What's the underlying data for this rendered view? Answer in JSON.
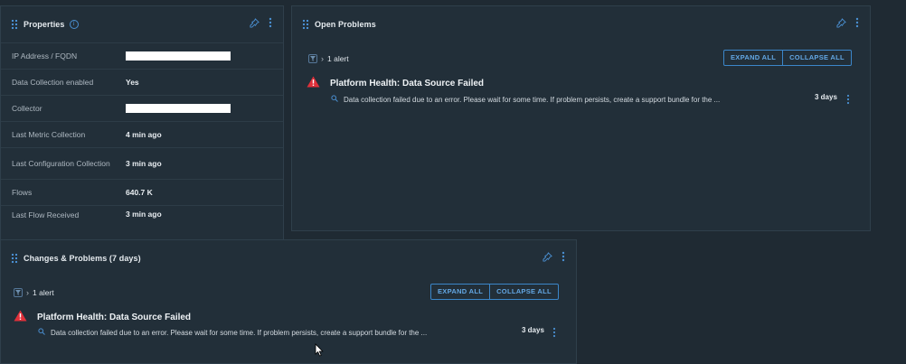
{
  "properties": {
    "title": "Properties",
    "rows": [
      {
        "key": "IP Address / FQDN",
        "value": ""
      },
      {
        "key": "Data Collection enabled",
        "value": "Yes"
      },
      {
        "key": "Collector",
        "value": ""
      },
      {
        "key": "Last Metric Collection",
        "value": "4 min ago"
      },
      {
        "key": "Last Configuration Collection",
        "value": "3 min ago"
      },
      {
        "key": "Flows",
        "value": "640.7 K"
      },
      {
        "key": "Last Flow Received",
        "value": "3 min ago"
      }
    ]
  },
  "open_problems": {
    "title": "Open Problems",
    "alert_count": "1 alert",
    "expand_all": "EXPAND ALL",
    "collapse_all": "COLLAPSE ALL",
    "alert": {
      "title": "Platform Health: Data Source Failed",
      "description": "Data collection failed due to an error. Please wait for some time. If problem persists, create a support bundle for the ...",
      "age": "3 days"
    }
  },
  "changes_problems": {
    "title": "Changes & Problems (7 days)",
    "alert_count": "1 alert",
    "expand_all": "EXPAND ALL",
    "collapse_all": "COLLAPSE ALL",
    "alert": {
      "title": "Platform Health: Data Source Failed",
      "description": "Data collection failed due to an error. Please wait for some time. If problem persists, create a support bundle for the ...",
      "age": "3 days"
    }
  },
  "colors": {
    "background": "#1f2a33",
    "panel": "#222f39",
    "accent": "#3b86c9",
    "critical": "#e0303a"
  }
}
